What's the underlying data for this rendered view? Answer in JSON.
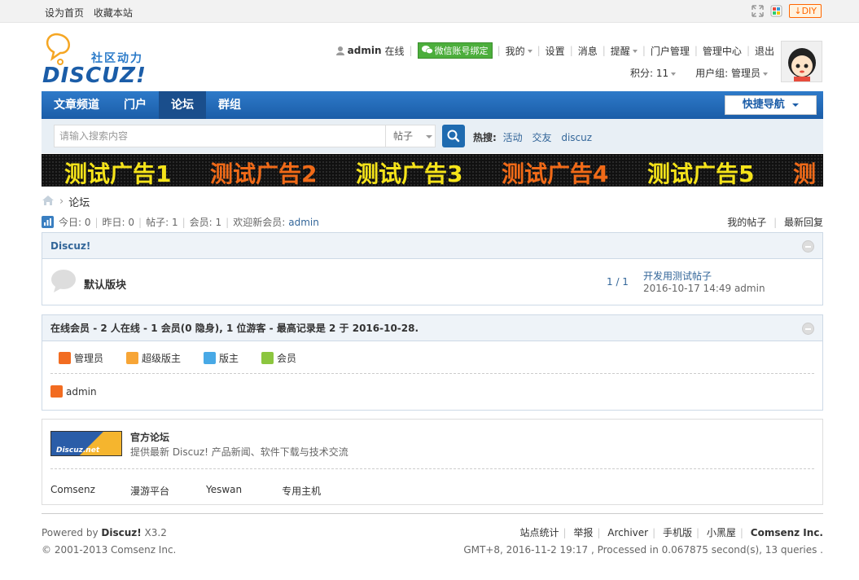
{
  "topbar": {
    "set_home": "设为首页",
    "bookmark": "收藏本站",
    "diy": "DIY"
  },
  "logo": {
    "subtitle": "社区动力",
    "wordmark": "DISCUZ!"
  },
  "user": {
    "name": "admin",
    "status": "在线",
    "wechat_bind": "微信账号绑定",
    "my": "我的",
    "settings": "设置",
    "messages": "消息",
    "reminders": "提醒",
    "portal_admin": "门户管理",
    "admin_center": "管理中心",
    "logout": "退出",
    "points_label": "积分: 11",
    "usergroup_label": "用户组: 管理员"
  },
  "nav": {
    "items": [
      {
        "label": "文章频道",
        "active": false
      },
      {
        "label": "门户",
        "active": false
      },
      {
        "label": "论坛",
        "active": true
      },
      {
        "label": "群组",
        "active": false
      }
    ],
    "quick_nav": "快捷导航"
  },
  "search": {
    "placeholder": "请输入搜索内容",
    "type": "帖子",
    "hot_label": "热搜:",
    "hot_terms": [
      "活动",
      "交友",
      "discuz"
    ]
  },
  "ad": {
    "items": [
      {
        "text": "测试广告1",
        "color": "#f5e31a"
      },
      {
        "text": "测试广告2",
        "color": "#f06a18"
      },
      {
        "text": "测试广告3",
        "color": "#f5e31a"
      },
      {
        "text": "测试广告4",
        "color": "#f06a18"
      },
      {
        "text": "测试广告5",
        "color": "#f5e31a"
      },
      {
        "text": "测",
        "color": "#f06a18"
      }
    ]
  },
  "breadcrumb": {
    "current": "论坛"
  },
  "stats": {
    "today": "今日: 0",
    "yesterday": "昨日: 0",
    "posts": "帖子: 1",
    "members": "会员: 1",
    "welcome_label": "欢迎新会员:",
    "newest_member": "admin",
    "my_posts": "我的帖子",
    "latest_replies": "最新回复"
  },
  "category": {
    "title": "Discuz!",
    "forum": {
      "name": "默认版块",
      "counts": "1 / 1",
      "last_post_title": "开发用测试帖子",
      "last_post_meta": "2016-10-17 14:49 admin"
    }
  },
  "online": {
    "title": "在线会员",
    "summary": " - 2 人在线 - 1 会员(0 隐身), 1 位游客 - 最高记录是 2 于 2016-10-28.",
    "legend": [
      {
        "label": "管理员",
        "color": "#f26c21"
      },
      {
        "label": "超级版主",
        "color": "#f7a536"
      },
      {
        "label": "版主",
        "color": "#48a9e6"
      },
      {
        "label": "会员",
        "color": "#8cc63f"
      }
    ],
    "users": [
      {
        "name": "admin",
        "color": "#f26c21"
      }
    ]
  },
  "friendlinks": {
    "featured_title": "官方论坛",
    "featured_desc": "提供最新 Discuz! 产品新闻、软件下载与技术交流",
    "logo_text": "Discuz.net",
    "links": [
      "Comsenz",
      "漫游平台",
      "Yeswan",
      "专用主机"
    ]
  },
  "footer": {
    "powered_prefix": "Powered by ",
    "powered_brand": "Discuz!",
    "version": " X3.2",
    "copyright": "© 2001-2013 Comsenz Inc.",
    "links": [
      "站点统计",
      "举报",
      "Archiver",
      "手机版",
      "小黑屋"
    ],
    "company": "Comsenz Inc.",
    "processed": "GMT+8, 2016-11-2 19:17 , Processed in 0.067875 second(s), 13 queries ."
  }
}
